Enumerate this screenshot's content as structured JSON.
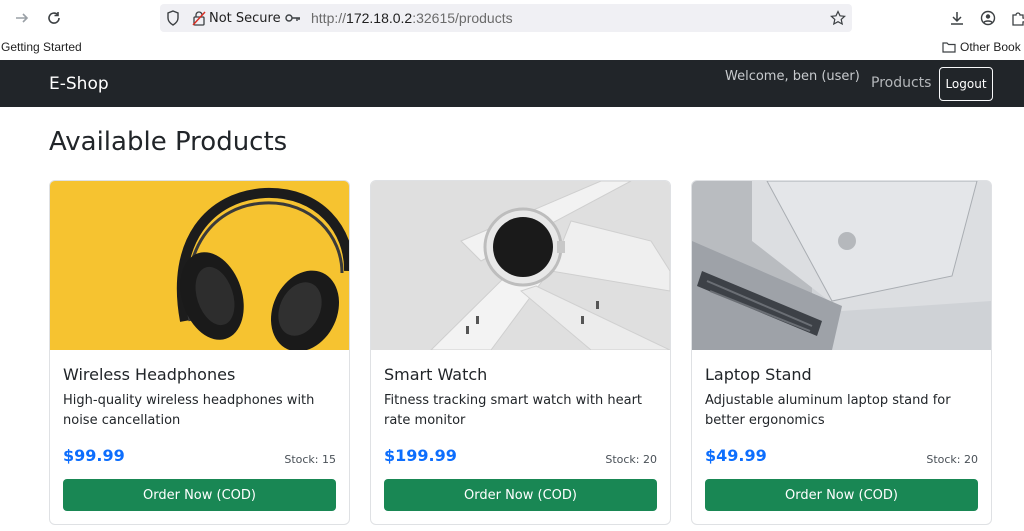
{
  "browser": {
    "security_label": "Not Secure",
    "url_prefix": "http://",
    "url_host": "172.18.0.2",
    "url_rest": ":32615/products",
    "bookmarks": {
      "getting_started": "Getting Started",
      "other_bookmarks": "Other Book"
    }
  },
  "navbar": {
    "brand": "E-Shop",
    "welcome": "Welcome, ben (user)",
    "products_link": "Products",
    "logout": "Logout"
  },
  "main": {
    "title": "Available Products",
    "products": [
      {
        "name": "Wireless Headphones",
        "description": "High-quality wireless headphones with noise cancellation",
        "price": "$99.99",
        "stock": "Stock: 15",
        "button": "Order Now (COD)",
        "image": "headphones-photo"
      },
      {
        "name": "Smart Watch",
        "description": "Fitness tracking smart watch with heart rate monitor",
        "price": "$199.99",
        "stock": "Stock: 20",
        "button": "Order Now (COD)",
        "image": "smartwatch-photo"
      },
      {
        "name": "Laptop Stand",
        "description": "Adjustable aluminum laptop stand for better ergonomics",
        "price": "$49.99",
        "stock": "Stock: 20",
        "button": "Order Now (COD)",
        "image": "laptop-photo"
      }
    ]
  },
  "colors": {
    "navbar": "#212529",
    "price": "#0d6efd",
    "order_button": "#198754"
  }
}
